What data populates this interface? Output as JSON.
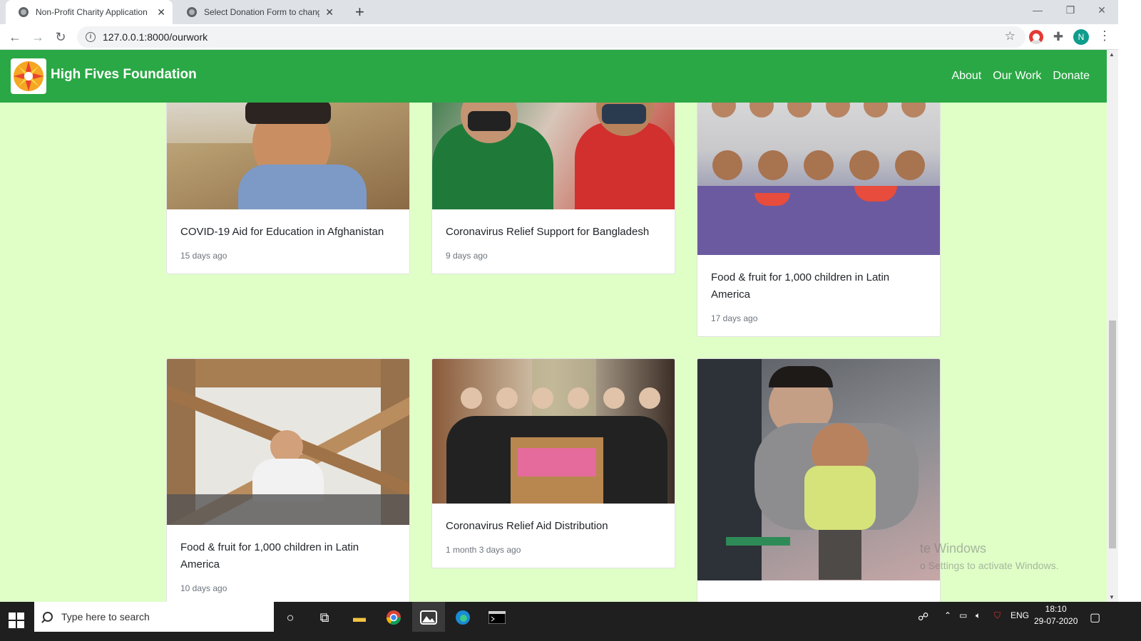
{
  "browser": {
    "tabs": [
      {
        "title": "Non-Profit Charity Application",
        "active": true
      },
      {
        "title": "Select Donation Form to change",
        "active": false
      }
    ],
    "url": "127.0.0.1:8000/ourwork",
    "profile_initial": "N"
  },
  "site": {
    "brand": "High Fives Foundation",
    "nav": [
      "About",
      "Our Work",
      "Donate"
    ],
    "colors": {
      "nav": "#2aa845",
      "background": "#dfffc7"
    }
  },
  "cards": [
    {
      "title": "COVID-19 Aid for Education in Afghanistan",
      "meta": "15 days ago"
    },
    {
      "title": "Coronavirus Relief Support for Bangladesh",
      "meta": "9 days ago"
    },
    {
      "title": "Food & fruit for 1,000 children in Latin America",
      "meta": "17 days ago"
    },
    {
      "title": "Food & fruit for 1,000 children in Latin America",
      "meta": "10 days ago"
    },
    {
      "title": "Coronavirus Relief Aid Distribution",
      "meta": "1 month 3 days ago"
    },
    {
      "title": "",
      "meta": ""
    }
  ],
  "watermark": {
    "line1": "te Windows",
    "line2": "o Settings to activate Windows."
  },
  "taskbar": {
    "search_placeholder": "Type here to search",
    "lang": "ENG",
    "time": "18:10",
    "date": "29-07-2020"
  }
}
